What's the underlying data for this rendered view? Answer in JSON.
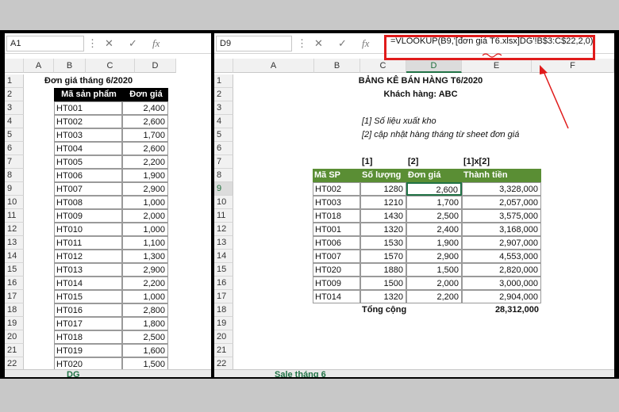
{
  "left": {
    "name_box": "A1",
    "fx_icon": "fx-icon",
    "columns": [
      "A",
      "B",
      "C",
      "D"
    ],
    "rows": [
      "1",
      "2",
      "3",
      "4",
      "5",
      "6",
      "7",
      "8",
      "9",
      "10",
      "11",
      "12",
      "13",
      "14",
      "15",
      "16",
      "17",
      "18",
      "19",
      "20",
      "21",
      "22"
    ],
    "title": "Đơn giá tháng 6/2020",
    "headers": [
      "Mã sản phẩm",
      "Đơn giá"
    ],
    "products": [
      [
        "HT001",
        "2,400"
      ],
      [
        "HT002",
        "2,600"
      ],
      [
        "HT003",
        "1,700"
      ],
      [
        "HT004",
        "2,600"
      ],
      [
        "HT005",
        "2,200"
      ],
      [
        "HT006",
        "1,900"
      ],
      [
        "HT007",
        "2,900"
      ],
      [
        "HT008",
        "1,000"
      ],
      [
        "HT009",
        "2,000"
      ],
      [
        "HT010",
        "1,000"
      ],
      [
        "HT011",
        "1,100"
      ],
      [
        "HT012",
        "1,300"
      ],
      [
        "HT013",
        "2,900"
      ],
      [
        "HT014",
        "2,200"
      ],
      [
        "HT015",
        "1,000"
      ],
      [
        "HT016",
        "2,800"
      ],
      [
        "HT017",
        "1,800"
      ],
      [
        "HT018",
        "2,500"
      ],
      [
        "HT019",
        "1,600"
      ],
      [
        "HT020",
        "1,500"
      ]
    ],
    "sheet_tab": "DG"
  },
  "right": {
    "name_box": "D9",
    "formula": "=VLOOKUP(B9,'[đơn giá T6.xlsx]DG'!B$3:C$22,2,0)",
    "columns": [
      "A",
      "B",
      "C",
      "D",
      "E",
      "F"
    ],
    "rows": [
      "1",
      "2",
      "3",
      "4",
      "5",
      "6",
      "7",
      "8",
      "9",
      "10",
      "11",
      "12",
      "13",
      "14",
      "15",
      "16",
      "17",
      "18",
      "19",
      "20",
      "21",
      "22"
    ],
    "title": "BẢNG KÊ BÁN HÀNG T6/2020",
    "customer": "Khách hàng: ABC",
    "note1": "[1] Số liệu xuất kho",
    "note2": "[2] cập nhật hàng tháng từ sheet đơn giá",
    "col_tags": [
      "[1]",
      "[2]",
      "[1]x[2]"
    ],
    "headers": [
      "Mã SP",
      "Số lượng",
      "Đơn giá",
      "Thành tiền"
    ],
    "sales": [
      [
        "HT002",
        "1280",
        "2,600",
        "3,328,000"
      ],
      [
        "HT003",
        "1210",
        "1,700",
        "2,057,000"
      ],
      [
        "HT018",
        "1430",
        "2,500",
        "3,575,000"
      ],
      [
        "HT001",
        "1320",
        "2,400",
        "3,168,000"
      ],
      [
        "HT006",
        "1530",
        "1,900",
        "2,907,000"
      ],
      [
        "HT007",
        "1570",
        "2,900",
        "4,553,000"
      ],
      [
        "HT020",
        "1880",
        "1,500",
        "2,820,000"
      ],
      [
        "HT009",
        "1500",
        "2,000",
        "3,000,000"
      ],
      [
        "HT014",
        "1320",
        "2,200",
        "2,904,000"
      ]
    ],
    "total_label": "Tổng cộng",
    "total_value": "28,312,000",
    "sheet_tab": "Sale tháng 6"
  },
  "colors": {
    "header_green": "#5a8e34",
    "highlight_red": "#e01b1b",
    "selection": "#217346"
  }
}
